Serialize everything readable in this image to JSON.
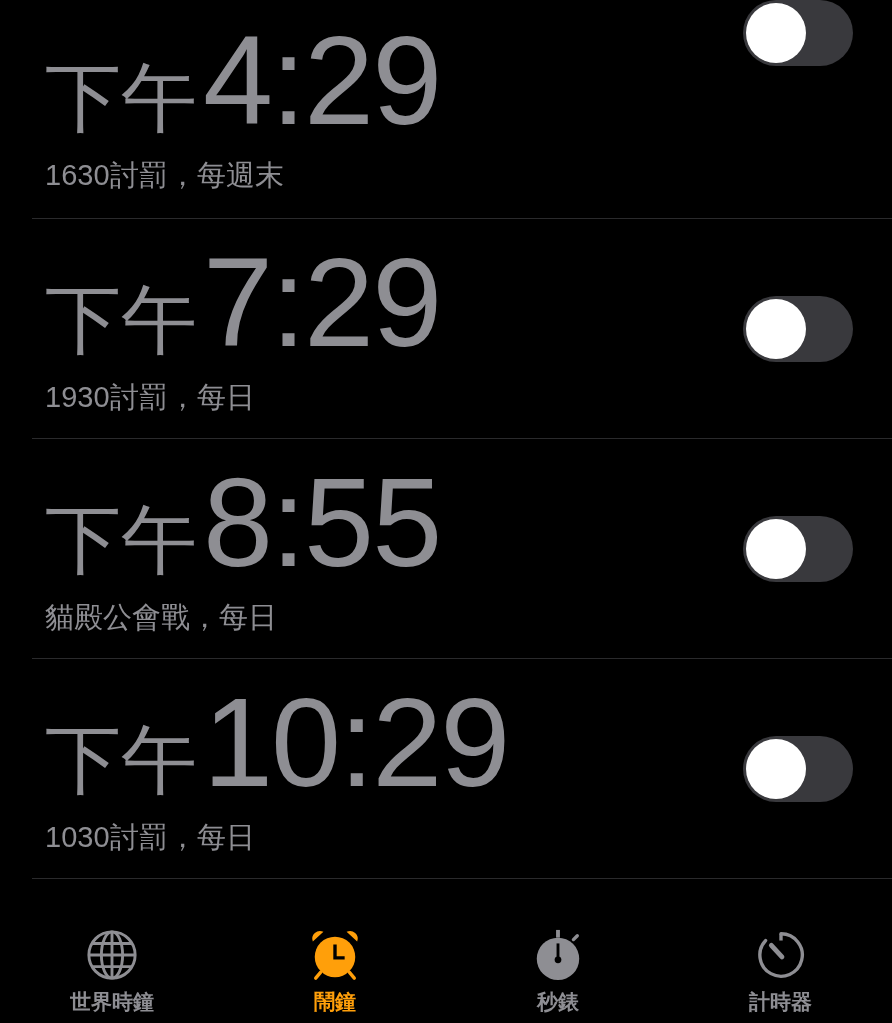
{
  "alarms": [
    {
      "period": "下午",
      "time": "4:29",
      "label": "1630討罰，每週末",
      "on": false
    },
    {
      "period": "下午",
      "time": "7:29",
      "label": "1930討罰，每日",
      "on": false
    },
    {
      "period": "下午",
      "time": "8:55",
      "label": "貓殿公會戰，每日",
      "on": false
    },
    {
      "period": "下午",
      "time": "10:29",
      "label": "1030討罰，每日",
      "on": false
    }
  ],
  "tabs": [
    {
      "kind": "globe",
      "label": "世界時鐘",
      "selected": false
    },
    {
      "kind": "alarm",
      "label": "鬧鐘",
      "selected": true
    },
    {
      "kind": "stopwatch",
      "label": "秒錶",
      "selected": false
    },
    {
      "kind": "timer",
      "label": "計時器",
      "selected": false
    }
  ]
}
